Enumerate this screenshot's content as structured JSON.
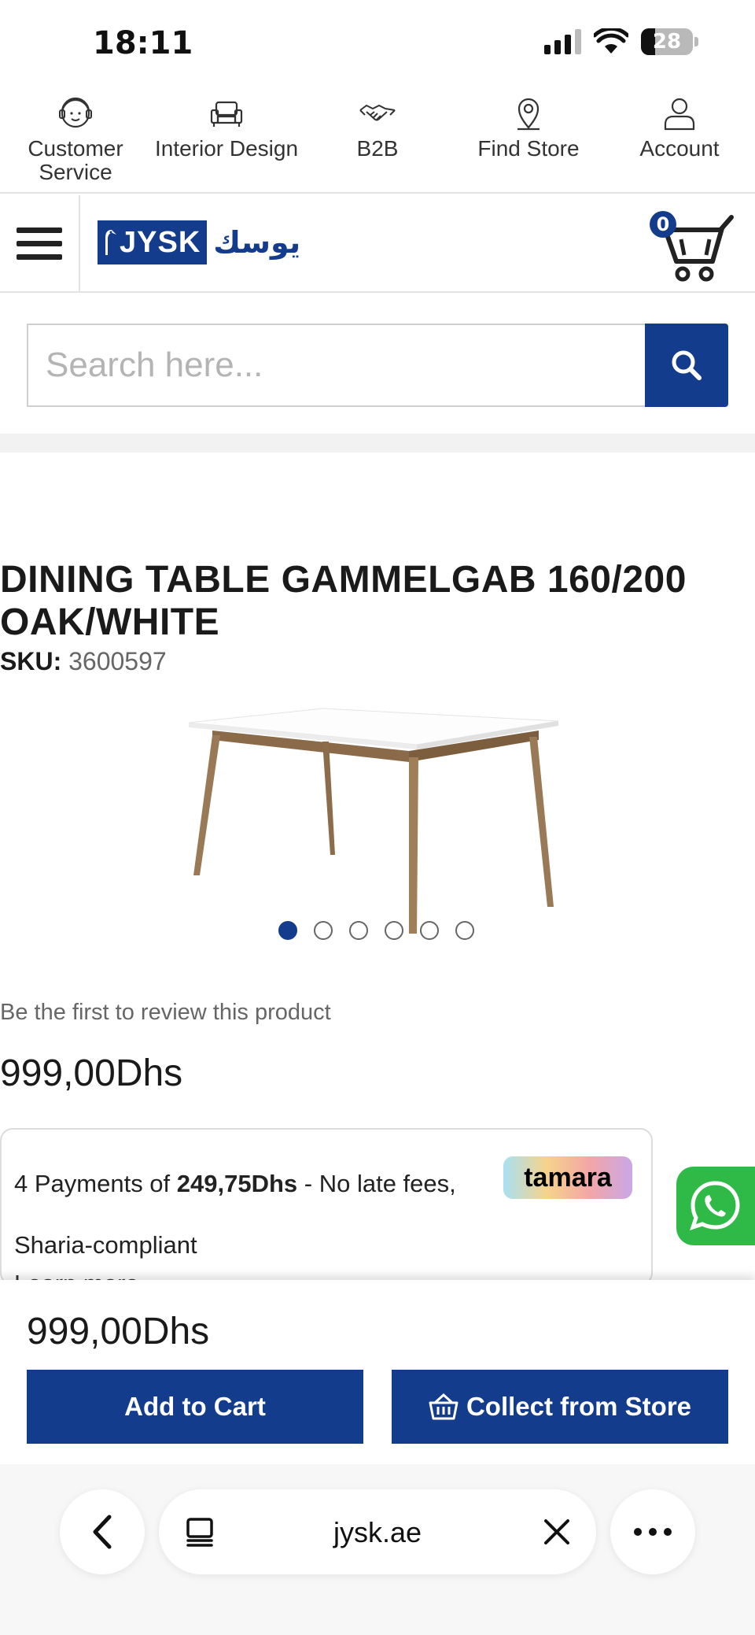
{
  "status_bar": {
    "time": "18:11",
    "battery": "28",
    "battery_level": 0.28
  },
  "utility_nav": [
    {
      "label": "Customer Service",
      "icon": "customer-service-icon"
    },
    {
      "label": "Interior Design",
      "icon": "armchair-icon"
    },
    {
      "label": "B2B",
      "icon": "handshake-icon"
    },
    {
      "label": "Find Store",
      "icon": "location-pin-icon"
    },
    {
      "label": "Account",
      "icon": "user-icon"
    }
  ],
  "header": {
    "logo_text": "JYSK",
    "logo_arabic": "يوسك",
    "cart_count": "0"
  },
  "search": {
    "placeholder": "Search here..."
  },
  "product": {
    "title": "DINING TABLE GAMMELGAB 160/200 OAK/WHITE",
    "sku_label": "SKU:",
    "sku_value": "3600597",
    "image_count": 6,
    "active_image": 1,
    "review_text": "Be the first to review this product",
    "price": "999,00Dhs"
  },
  "tamara": {
    "prefix": "4 Payments of ",
    "amount": "249,75Dhs",
    "suffix_line1": " - No late fees,",
    "line2": "Sharia-compliant",
    "learn_more": "Learn more",
    "logo": "tamara"
  },
  "sticky_bar": {
    "price": "999,00Dhs",
    "add_to_cart": "Add to Cart",
    "collect_from_store": "Collect from Store"
  },
  "browser": {
    "url": "jysk.ae"
  },
  "colors": {
    "brand": "#143c8c",
    "whatsapp": "#2fb946"
  }
}
